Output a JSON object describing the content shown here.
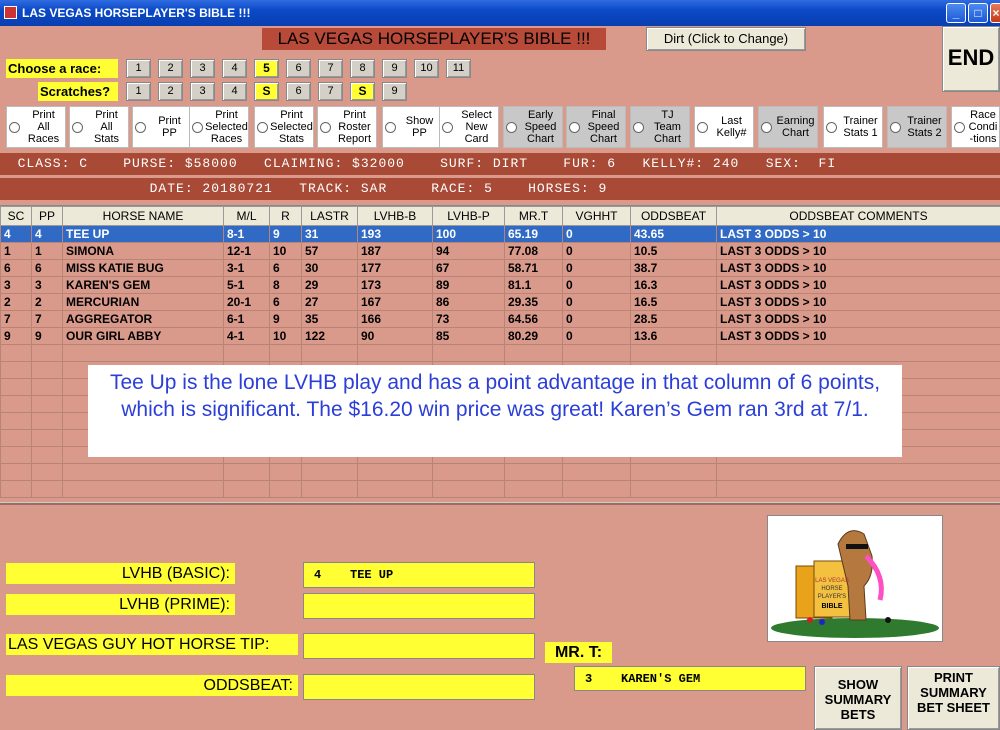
{
  "window": {
    "title": "LAS VEGAS HORSEPLAYER'S BIBLE !!!"
  },
  "banner": "LAS VEGAS HORSEPLAYER'S BIBLE !!!",
  "surface_button": "Dirt (Click to Change)",
  "end_button": "END",
  "race_label": "Choose  a race:",
  "scratch_label": "Scratches?",
  "races": [
    "1",
    "2",
    "3",
    "4",
    "5",
    "6",
    "7",
    "8",
    "9",
    "10",
    "11"
  ],
  "selected_race": "5",
  "scratches": [
    "1",
    "2",
    "3",
    "4",
    "S",
    "6",
    "7",
    "S",
    "9"
  ],
  "options": [
    {
      "label": "Print\nAll\nRaces",
      "style": "white"
    },
    {
      "label": "Print\nAll\nStats",
      "style": "white"
    },
    {
      "label": "Print\nPP",
      "style": "white"
    },
    {
      "label": "Print\nSelected\nRaces",
      "style": "white"
    },
    {
      "label": "Print\nSelected\nStats",
      "style": "white"
    },
    {
      "label": "Print\nRoster\nReport",
      "style": "white"
    },
    {
      "label": "Show\nPP",
      "style": "white"
    },
    {
      "label": "Select\nNew\nCard",
      "style": "white"
    },
    {
      "label": "Early\nSpeed\nChart",
      "style": "gray"
    },
    {
      "label": "Final\nSpeed\nChart",
      "style": "gray"
    },
    {
      "label": "TJ\nTeam\nChart",
      "style": "gray"
    },
    {
      "label": "Last\nKelly#",
      "style": "white"
    },
    {
      "label": "Earning\nChart",
      "style": "gray"
    },
    {
      "label": "Trainer\nStats 1",
      "style": "white"
    },
    {
      "label": "Trainer\nStats 2",
      "style": "gray"
    },
    {
      "label": "Race\nCondi\n-tions",
      "style": "white"
    }
  ],
  "race_info": {
    "line1": "  CLASS: C    PURSE: $58000   CLAIMING: $32000    SURF: DIRT    FUR: 6   KELLY#: 240   SEX:  FI",
    "line2": "                 DATE: 20180721   TRACK: SAR     RACE: 5    HORSES: 9"
  },
  "table": {
    "columns": [
      "SC",
      "PP",
      "HORSE NAME",
      "M/L",
      "R",
      "LASTR",
      "LVHB-B",
      "LVHB-P",
      "MR.T",
      "VGHHT",
      "ODDSBEAT",
      "ODDSBEAT COMMENTS"
    ],
    "rows": [
      [
        "4",
        "4",
        "TEE UP",
        "8-1",
        "9",
        "31",
        "193",
        "100",
        "65.19",
        "0",
        "43.65",
        "LAST 3 ODDS > 10"
      ],
      [
        "1",
        "1",
        "SIMONA",
        "12-1",
        "10",
        "57",
        "187",
        "94",
        "77.08",
        "0",
        "10.5",
        "LAST 3 ODDS > 10"
      ],
      [
        "6",
        "6",
        "MISS KATIE BUG",
        "3-1",
        "6",
        "30",
        "177",
        "67",
        "58.71",
        "0",
        "38.7",
        "LAST 3 ODDS > 10"
      ],
      [
        "3",
        "3",
        "KAREN'S GEM",
        "5-1",
        "8",
        "29",
        "173",
        "89",
        "81.1",
        "0",
        "16.3",
        "LAST 3 ODDS > 10"
      ],
      [
        "2",
        "2",
        "MERCURIAN",
        "20-1",
        "6",
        "27",
        "167",
        "86",
        "29.35",
        "0",
        "16.5",
        "LAST 3 ODDS > 10"
      ],
      [
        "7",
        "7",
        "AGGREGATOR",
        "6-1",
        "9",
        "35",
        "166",
        "73",
        "64.56",
        "0",
        "28.5",
        "LAST 3 ODDS > 10"
      ],
      [
        "9",
        "9",
        "OUR GIRL ABBY",
        "4-1",
        "10",
        "122",
        "90",
        "85",
        "80.29",
        "0",
        "13.6",
        "LAST 3 ODDS > 10"
      ]
    ],
    "selected_row": 0
  },
  "annotation": "Tee Up is the lone LVHB play and has a point advantage in that column of 6 points, which is significant.  The $16.20 win price was great!  Karen’s Gem ran 3rd at 7/1.",
  "picks": {
    "basic_label": "LVHB (BASIC):",
    "basic_value": "4    TEE UP",
    "prime_label": "LVHB (PRIME):",
    "prime_value": "",
    "hot_label": "LAS VEGAS GUY HOT HORSE TIP:",
    "hot_value": "",
    "oddsbeat_label": "ODDSBEAT:",
    "oddsbeat_value": "",
    "mrt_label": "MR. T:",
    "mrt_value": "3    KAREN'S GEM"
  },
  "logo_text": [
    "LAS VEGAS",
    "HORSE",
    "PLAYER'S",
    "BIBLE"
  ],
  "buttons": {
    "show_summary": "SHOW SUMMARY BETS",
    "print_summary": "PRINT SUMMARY BET SHEET"
  },
  "colors": {
    "highlight_yellow": "#ffff33",
    "selected_row": "#316ac5",
    "annotation_text": "#2b3fd8",
    "info_bar": "#a84a36"
  }
}
